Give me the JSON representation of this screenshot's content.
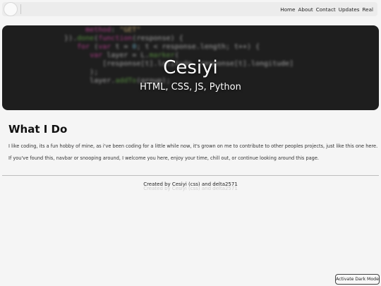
{
  "navbar": {
    "links": [
      {
        "label": "Home"
      },
      {
        "label": "About"
      },
      {
        "label": "Contact"
      },
      {
        "label": "Updates"
      },
      {
        "label": "Real"
      }
    ]
  },
  "hero": {
    "title": "Cesiyi",
    "subtitle": "HTML, CSS, JS, Python"
  },
  "main": {
    "heading": "What I Do",
    "paragraphs": [
      "I like coding, its a fun hobby of mine, as i've been coding for a little while now, it's grown on me to contribute to other peoples projects, just like this one here.",
      "If you've found this, navbar or snooping around, I welcome you here, enjoy your time, chill out, or continue looking around this page."
    ]
  },
  "footer": {
    "text": "Created by Cesiyi (css) and delta2571"
  },
  "dark_mode_button": {
    "label": "Activate Dark Mode"
  }
}
